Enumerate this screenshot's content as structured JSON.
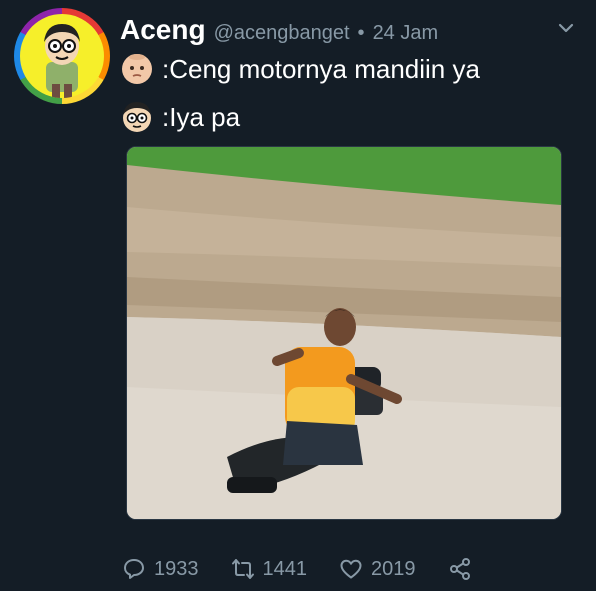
{
  "tweet": {
    "display_name": "Aceng",
    "handle": "@acengbanget",
    "separator": "•",
    "time": "24 Jam",
    "lines": [
      {
        "emoji": "baby-face-emoji",
        "text": ":Ceng motornya mandiin ya"
      },
      {
        "emoji": "boy-glasses-emoji",
        "text": ":Iya pa"
      }
    ],
    "media": {
      "type": "video-still",
      "description_icon": "video-thumbnail"
    },
    "actions": {
      "reply_count": "1933",
      "retweet_count": "1441",
      "like_count": "2019"
    }
  },
  "colors": {
    "background": "#141d26",
    "secondary_text": "#8899a6",
    "primary_text": "#ffffff"
  },
  "icons": [
    "reply-icon",
    "retweet-icon",
    "like-icon",
    "share-icon",
    "chevron-down-icon"
  ]
}
